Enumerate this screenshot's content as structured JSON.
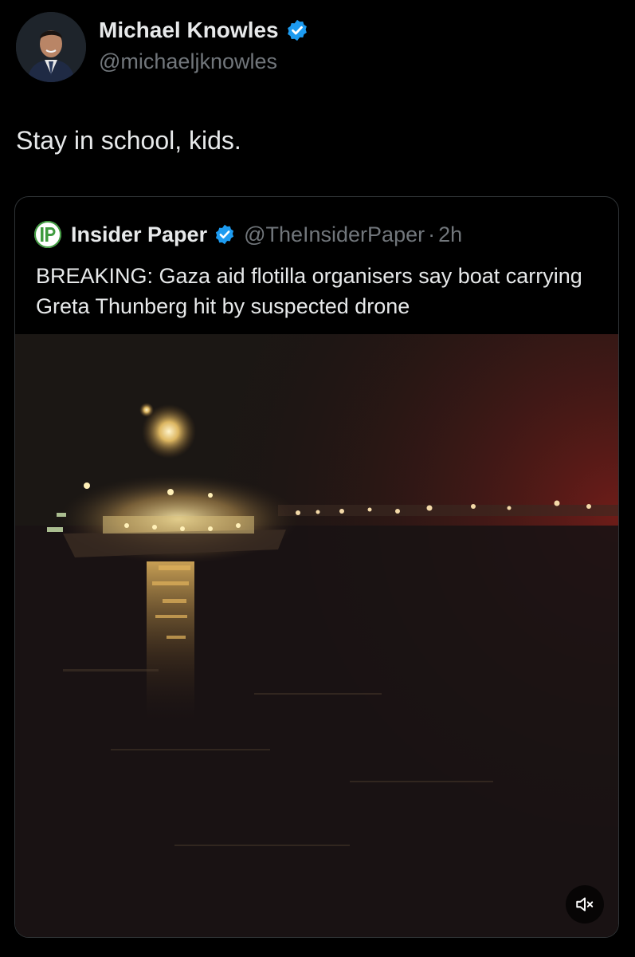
{
  "author": {
    "name": "Michael Knowles",
    "handle": "@michaeljknowles",
    "verified_icon": "verified-badge-icon"
  },
  "tweet": {
    "text": "Stay in school, kids."
  },
  "quoted_tweet": {
    "name": "Insider Paper",
    "handle": "@TheInsiderPaper",
    "separator": "·",
    "time": "2h",
    "avatar_letters": "IP",
    "text": "BREAKING: Gaza aid flotilla organisers say boat carrying Greta Thunberg hit by suspected drone",
    "media": {
      "type": "video",
      "mute_icon": "speaker-muted-icon"
    }
  },
  "colors": {
    "background": "#000000",
    "text_primary": "#e7e9ea",
    "text_secondary": "#71767b",
    "border": "#2f3336",
    "verified_blue": "#1d9bf0",
    "brand_green": "#3f9b3f"
  }
}
